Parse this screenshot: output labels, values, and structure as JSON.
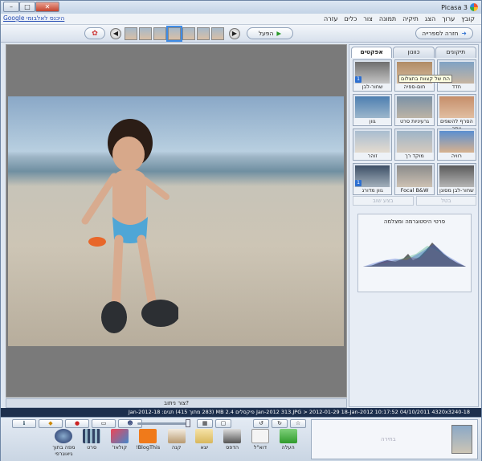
{
  "window": {
    "title": "Picasa 3",
    "controls": {
      "minimize": "–",
      "maximize": "□",
      "close": "✕"
    }
  },
  "menu": {
    "items": [
      "קובץ",
      "ערוך",
      "הצג",
      "תיקיה",
      "תמונה",
      "צור",
      "כלים",
      "עזרה"
    ],
    "album_link": "היכנס לאלבומי Google"
  },
  "toolbar": {
    "back_label": "חזרה לספרייה",
    "play_label": "הפעל"
  },
  "viewer": {
    "status": "צור ניתוב?"
  },
  "panel": {
    "tabs": [
      "תיקונים בסיסיים",
      "כוונון",
      "אפקטים"
    ],
    "effects": [
      {
        "label": "חדד",
        "badge": ""
      },
      {
        "label": "חום-ספיה",
        "badge": ""
      },
      {
        "label": "שחור-לבן",
        "badge": "1"
      },
      {
        "label": "הסרף להשפים יותר",
        "badge": ""
      },
      {
        "label": "גרעיניות סרט",
        "badge": ""
      },
      {
        "label": "גוון",
        "badge": ""
      },
      {
        "label": "רוויה",
        "badge": ""
      },
      {
        "label": "מוקד רך",
        "badge": ""
      },
      {
        "label": "זוהר",
        "badge": ""
      },
      {
        "label": "שחור-לבן מסונן",
        "badge": ""
      },
      {
        "label": "Focal B&W",
        "badge": ""
      },
      {
        "label": "גוון מדורג",
        "badge": "1"
      }
    ],
    "tooltip": "הת של קצוות בתצלום",
    "undo_label": "בטל",
    "redo_label": "בצע שוב",
    "histogram_title": "פרטי היסטוגרמה ומצלמה"
  },
  "infobar": {
    "text": "18-Jan-2012   313.JPG > 2012-01-29 18-Jan-2012      10:17:52 04/10/2011   4320x3240 פיקסלים   2.4 MB (283 מתוך 415)   תגים: 18-Jan-2012"
  },
  "bottom": {
    "tray_label": "בחירה",
    "actions": [
      "העלה",
      "דוא\"ל",
      "הדפס",
      "יצא",
      "קנה",
      "BlogThis!",
      "קולאז'",
      "סרט",
      "מפה בתוך גיאוגרפי"
    ]
  },
  "colors": {
    "accent": "#3f8ce6",
    "infobar": "#1d2f4d"
  }
}
